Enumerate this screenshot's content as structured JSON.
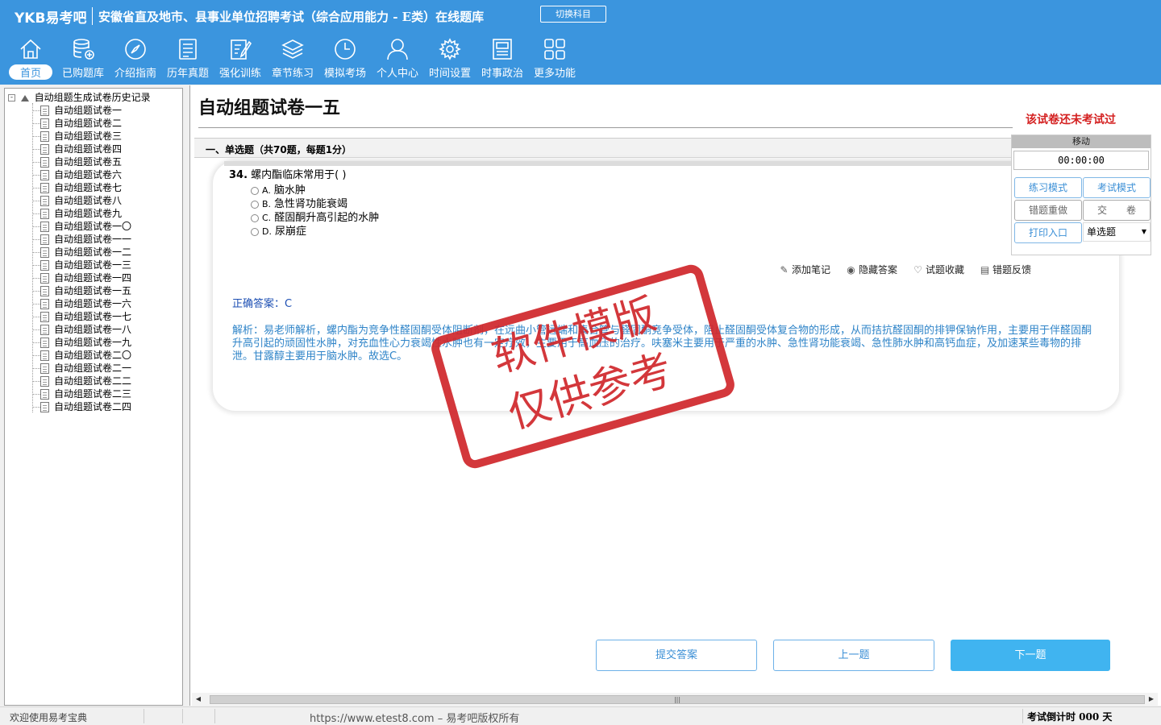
{
  "header": {
    "brand": "YKB易考吧",
    "title": "安徽省直及地市、县事业单位招聘考试（综合应用能力 - E类）在线题库",
    "switch_subject": "切换科目"
  },
  "nav": [
    {
      "label": "首页",
      "icon": "home-icon"
    },
    {
      "label": "已购题库",
      "icon": "database-icon"
    },
    {
      "label": "介绍指南",
      "icon": "compass-icon"
    },
    {
      "label": "历年真题",
      "icon": "list-icon"
    },
    {
      "label": "强化训练",
      "icon": "edit-icon"
    },
    {
      "label": "章节练习",
      "icon": "layers-icon"
    },
    {
      "label": "模拟考场",
      "icon": "clock-icon"
    },
    {
      "label": "个人中心",
      "icon": "user-icon"
    },
    {
      "label": "时间设置",
      "icon": "gear-icon"
    },
    {
      "label": "时事政治",
      "icon": "news-icon"
    },
    {
      "label": "更多功能",
      "icon": "grid-icon"
    }
  ],
  "tree": {
    "root": "自动组题生成试卷历史记录",
    "expander": "-",
    "items": [
      "自动组题试卷一",
      "自动组题试卷二",
      "自动组题试卷三",
      "自动组题试卷四",
      "自动组题试卷五",
      "自动组题试卷六",
      "自动组题试卷七",
      "自动组题试卷八",
      "自动组题试卷九",
      "自动组题试卷一〇",
      "自动组题试卷一一",
      "自动组题试卷一二",
      "自动组题试卷一三",
      "自动组题试卷一四",
      "自动组题试卷一五",
      "自动组题试卷一六",
      "自动组题试卷一七",
      "自动组题试卷一八",
      "自动组题试卷一九",
      "自动组题试卷二〇",
      "自动组题试卷二一",
      "自动组题试卷二二",
      "自动组题试卷二三",
      "自动组题试卷二四"
    ],
    "selected_index": 14
  },
  "paper": {
    "title": "自动组题试卷一五",
    "status": "该试卷还未考试过",
    "section": "一、单选题（共70题，每题1分）"
  },
  "question": {
    "number": "34.",
    "stem": "螺内酯临床常用于( )",
    "options": [
      {
        "key": "A.",
        "text": "脑水肿"
      },
      {
        "key": "B.",
        "text": "急性肾功能衰竭"
      },
      {
        "key": "C.",
        "text": "醛固酮升高引起的水肿"
      },
      {
        "key": "D.",
        "text": "尿崩症"
      }
    ],
    "correct_answer": "正确答案：C",
    "analysis": "解析：易老师解析，螺内酯为竞争性醛固酮受体阻断剂，在远曲小管远端和集合管与醛固酮竞争受体，阻止醛固酮受体复合物的形成，从而拮抗醛固酮的排钾保钠作用，主要用于伴醛固酮升高引起的顽固性水肿，对充血性心力衰竭性水肿也有一定疗效，主要用于高血压的治疗。呋塞米主要用于严重的水肿、急性肾功能衰竭、急性肺水肿和高钙血症，及加速某些毒物的排泄。甘露醇主要用于脑水肿。故选C。"
  },
  "tools": {
    "add_note": "添加笔记",
    "hide_answer": "隐藏答案",
    "favorite": "试题收藏",
    "feedback": "错题反馈"
  },
  "float_panel": {
    "move": "移动",
    "timer": "00:00:00",
    "practice_mode": "练习模式",
    "exam_mode": "考试模式",
    "redo_wrong": "错题重做",
    "submit_paper": "交　　卷",
    "print": "打印入口",
    "question_type": "单选题"
  },
  "bottom": {
    "submit": "提交答案",
    "prev": "上一题",
    "next": "下一题"
  },
  "stamp": {
    "line1": "软件模版",
    "line2": "仅供参考"
  },
  "status": {
    "welcome": "欢迎使用易考宝典",
    "copyright": "https://www.etest8.com – 易考吧版权所有",
    "countdown": "考试倒计时 000 天"
  }
}
